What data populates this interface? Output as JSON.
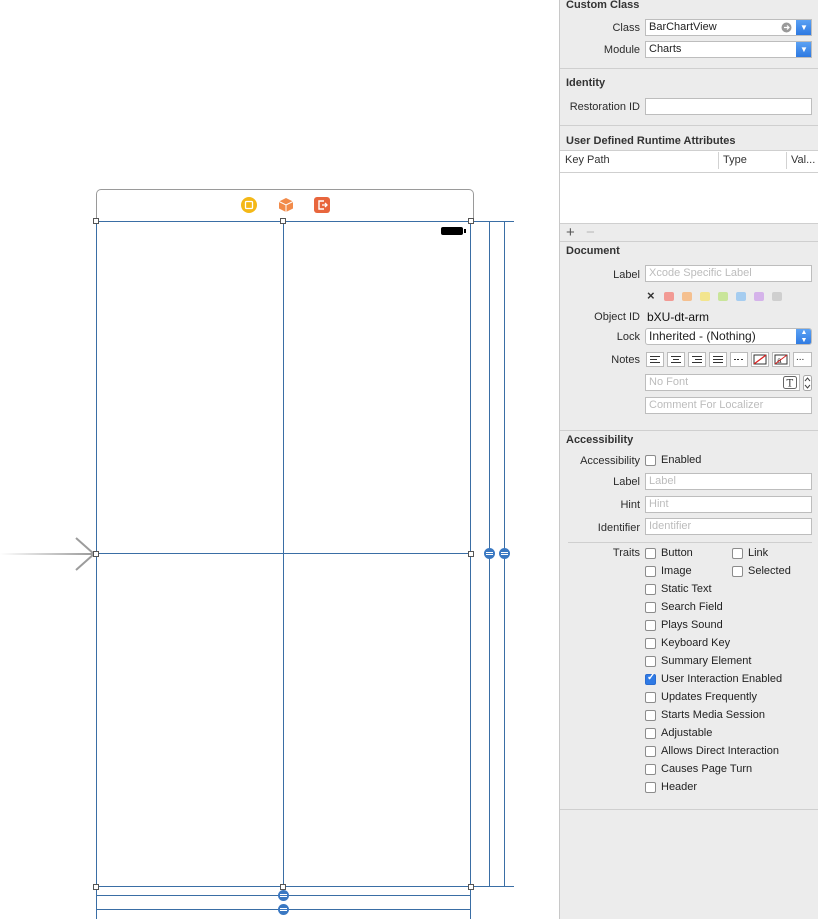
{
  "inspector": {
    "custom_class": {
      "title": "Custom Class",
      "class_label": "Class",
      "class_value": "BarChartView",
      "module_label": "Module",
      "module_value": "Charts"
    },
    "identity": {
      "title": "Identity",
      "restoration_label": "Restoration ID",
      "restoration_value": ""
    },
    "runtime_attributes": {
      "title": "User Defined Runtime Attributes",
      "columns": [
        "Key Path",
        "Type",
        "Val..."
      ],
      "add_label": "+",
      "remove_label": "−"
    },
    "document": {
      "title": "Document",
      "label_label": "Label",
      "label_placeholder": "Xcode Specific Label",
      "clear_label": "×",
      "swatch_colors": [
        "#f29a94",
        "#f5c08f",
        "#f3e58e",
        "#c9e59a",
        "#a6cdf0",
        "#d5b3ea",
        "#cfcfcf"
      ],
      "object_id_label": "Object ID",
      "object_id_value": "bXU-dt-arm",
      "lock_label": "Lock",
      "lock_value": "Inherited - (Nothing)",
      "notes_label": "Notes",
      "font_placeholder": "No Font",
      "comment_placeholder": "Comment For Localizer"
    },
    "accessibility": {
      "title": "Accessibility",
      "accessibility_label": "Accessibility",
      "enabled_label": "Enabled",
      "label_label": "Label",
      "label_placeholder": "Label",
      "hint_label": "Hint",
      "hint_placeholder": "Hint",
      "identifier_label": "Identifier",
      "identifier_placeholder": "Identifier",
      "traits_label": "Traits",
      "traits": [
        {
          "name": "Button",
          "checked": false
        },
        {
          "name": "Link",
          "checked": false
        },
        {
          "name": "Image",
          "checked": false
        },
        {
          "name": "Selected",
          "checked": false
        },
        {
          "name": "Static Text",
          "checked": false
        },
        {
          "name": "Search Field",
          "checked": false
        },
        {
          "name": "Plays Sound",
          "checked": false
        },
        {
          "name": "Keyboard Key",
          "checked": false
        },
        {
          "name": "Summary Element",
          "checked": false
        },
        {
          "name": "User Interaction Enabled",
          "checked": true
        },
        {
          "name": "Updates Frequently",
          "checked": false
        },
        {
          "name": "Starts Media Session",
          "checked": false
        },
        {
          "name": "Adjustable",
          "checked": false
        },
        {
          "name": "Allows Direct Interaction",
          "checked": false
        },
        {
          "name": "Causes Page Turn",
          "checked": false
        },
        {
          "name": "Header",
          "checked": false
        }
      ]
    }
  },
  "canvas": {
    "dock_icons": [
      "view-controller-icon",
      "first-responder-icon",
      "exit-icon"
    ],
    "accent_color": "#3a6ea5"
  }
}
